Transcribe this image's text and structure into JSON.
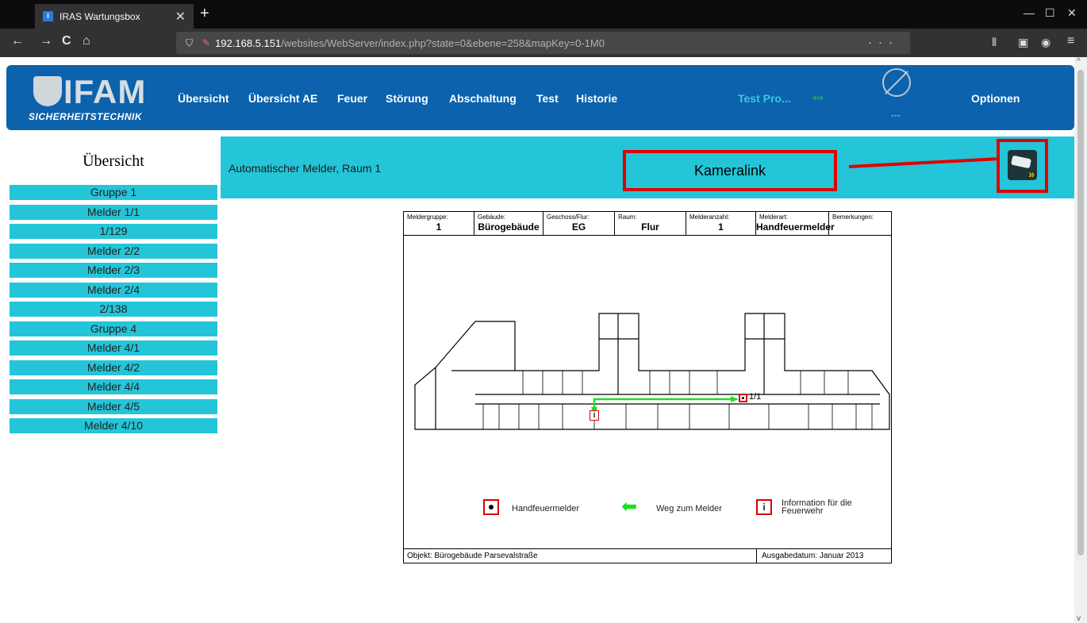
{
  "browser": {
    "tab_title": "IRAS Wartungsbox",
    "tab_close": "✕",
    "new_tab": "+",
    "url_host": "192.168.5.151",
    "url_path": "/websites/WebServer/index.php?state=0&ebene=258&mapKey=0-1M0",
    "url_more": "···",
    "back_icon": "←",
    "forward_icon": "→",
    "reload_icon": "C",
    "home_icon": "⌂",
    "minimize": "—",
    "maximize": "☐",
    "close": "✕",
    "menu_icon": "≡"
  },
  "header": {
    "logo_text": "IFAM",
    "logo_sub": "SICHERHEITSTECHNIK",
    "menu": [
      "Übersicht",
      "Übersicht AE",
      "Feuer",
      "Störung",
      "Abschaltung",
      "Test",
      "Historie"
    ],
    "test_status": "Test Pro...",
    "usb_icon": "usb-icon",
    "status_dashes": "---",
    "options": "Optionen",
    "accent_color": "#0c62ac"
  },
  "sidebar": {
    "title": "Übersicht",
    "items": [
      "Gruppe 1",
      "Melder 1/1",
      "1/129",
      "Melder 2/2",
      "Melder 2/3",
      "Melder 2/4",
      "2/138",
      "Gruppe 4",
      "Melder 4/1",
      "Melder 4/2",
      "Melder 4/4",
      "Melder 4/5",
      "Melder 4/10"
    ]
  },
  "banner": {
    "label": "Automatischer Melder, Raum 1",
    "kameralink": "Kameralink",
    "camera_icon": "camera-icon"
  },
  "plan": {
    "header": [
      {
        "key": "Meldergruppe:",
        "value": "1"
      },
      {
        "key": "Gebäude:",
        "value": "Bürogebäude"
      },
      {
        "key": "Geschoss/Flur:",
        "value": "EG"
      },
      {
        "key": "Raum:",
        "value": "Flur"
      },
      {
        "key": "Melderanzahl:",
        "value": "1"
      },
      {
        "key": "Melderart:",
        "value": "Handfeuermelder"
      },
      {
        "key": "Bemerkungen:",
        "value": ""
      }
    ],
    "marker_label": "1/1",
    "info_symbol": "i",
    "legend": {
      "handfeuermelder": "Handfeuermelder",
      "weg": "Weg zum Melder",
      "info_line1": "Information für die",
      "info_line2": "Feuerwehr"
    },
    "footer_left": "Objekt: Bürogebäude Parsevalstraße",
    "footer_right": "Ausgabedatum: Januar 2013"
  }
}
